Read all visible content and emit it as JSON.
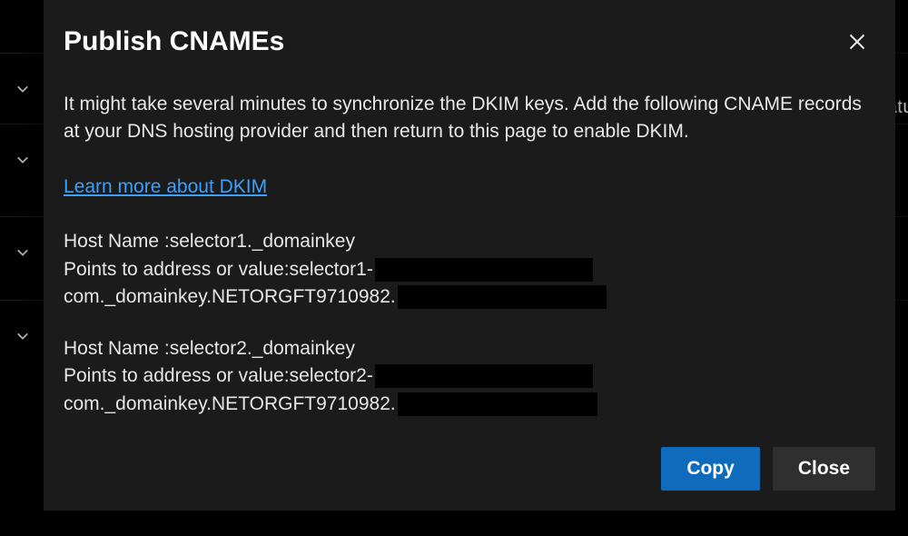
{
  "panel": {
    "title": "Publish CNAMEs",
    "description": "It might take several minutes to synchronize the DKIM keys. Add the following CNAME records at your DNS hosting provider and then return to this page to enable DKIM.",
    "learn_more": "Learn more about DKIM",
    "cname1": {
      "host_label": "Host Name : ",
      "host_value": "selector1._domainkey",
      "points_label": "Points to address or value: ",
      "points_value_part1": "selector1-",
      "points_value_part2": "com._domainkey.NETORGFT9710982."
    },
    "cname2": {
      "host_label": "Host Name : ",
      "host_value": "selector2._domainkey",
      "points_label": "Points to address or value: ",
      "points_value_part1": "selector2-",
      "points_value_part2": "com._domainkey.NETORGFT9710982."
    },
    "copy_label": "Copy",
    "close_label": "Close"
  },
  "background": {
    "cropped_text": "atu"
  }
}
